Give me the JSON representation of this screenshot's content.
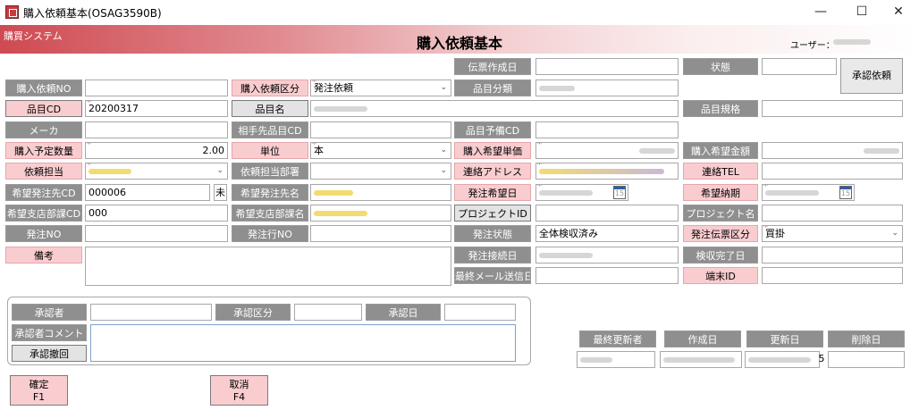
{
  "window": {
    "title": "購入依頼基本(OSAG3590B)",
    "minimize": "—",
    "maximize": "☐",
    "close": "✕"
  },
  "header": {
    "system": "購買システム",
    "title": "購入依頼基本",
    "user_label": "ユーザー："
  },
  "labels": {
    "denpyo_date": "伝票作成日",
    "status": "状態",
    "approve_request": "承認依頼",
    "request_no": "購入依頼NO",
    "request_type": "購入依頼区分",
    "item_class": "品目分類",
    "item_cd": "品目CD",
    "item_name": "品目名",
    "item_spec": "品目規格",
    "maker": "メーカ",
    "partner_item_cd": "相手先品目CD",
    "item_spare_cd": "品目予備CD",
    "planned_qty": "購入予定数量",
    "unit": "単位",
    "desired_price": "購入希望単価",
    "desired_amount": "購入希望金額",
    "person": "依頼担当",
    "dept": "依頼担当部署",
    "contact_addr": "連絡アドレス",
    "contact_tel": "連絡TEL",
    "vendor_cd": "希望発注先CD",
    "vendor_name": "希望発注先名",
    "order_date": "発注希望日",
    "delivery_date": "希望納期",
    "branch_cd": "希望支店部課CD",
    "branch_name": "希望支店部課名",
    "project_id": "プロジェクトID",
    "project_name": "プロジェクト名",
    "order_no": "発注NO",
    "order_line_no": "発注行NO",
    "order_status": "発注状態",
    "slip_type": "発注伝票区分",
    "remarks": "備考",
    "order_connect_date": "発注接続日",
    "inspect_date": "検収完了日",
    "last_mail_date": "最終メール送信日",
    "terminal_id": "端末ID",
    "approver": "承認者",
    "approval_type": "承認区分",
    "approval_date": "承認日",
    "approver_comment": "承認者コメント",
    "approval_withdraw": "承認撤回",
    "last_updater": "最終更新者",
    "created": "作成日",
    "updated": "更新日",
    "deleted": "削除日"
  },
  "values": {
    "request_type": "発注依頼",
    "item_cd": "20200317",
    "planned_qty": "2.00",
    "unit": "本",
    "vendor_cd": "000006",
    "vendor_suffix": "未",
    "branch_cd": "000",
    "order_status": "全体検収済み",
    "slip_type": "買掛",
    "cal_day": "15",
    "updated_suffix": "5"
  },
  "buttons": {
    "confirm": {
      "line1": "確定",
      "line2": "F1"
    },
    "cancel": {
      "line1": "取消",
      "line2": "F4"
    }
  },
  "colors": {
    "required_bg": "#f9cdd0",
    "label_bg": "#8f8f8f",
    "banner_start": "#cf4a52",
    "required_star": "#d0161d"
  },
  "icons": {
    "dropdown": "chevron-down-icon",
    "calendar": "calendar-icon",
    "app": "app-icon"
  }
}
